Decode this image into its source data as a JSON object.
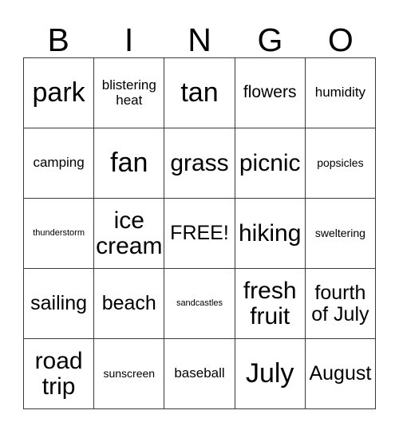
{
  "card": {
    "title_letters": [
      "B",
      "I",
      "N",
      "G",
      "O"
    ],
    "free_space_label": "FREE!",
    "border_color": "#3a3a3a",
    "background_color": "#ffffff",
    "text_color": "#000000",
    "columns": 5,
    "rows": 5,
    "cells": [
      {
        "text": "park",
        "size": "fs-max"
      },
      {
        "text": "blistering heat",
        "size": "fs-md"
      },
      {
        "text": "tan",
        "size": "fs-max"
      },
      {
        "text": "flowers",
        "size": "fs-lg"
      },
      {
        "text": "humidity",
        "size": "fs-md"
      },
      {
        "text": "camping",
        "size": "fs-md"
      },
      {
        "text": "fan",
        "size": "fs-max"
      },
      {
        "text": "grass",
        "size": "fs-xxl"
      },
      {
        "text": "picnic",
        "size": "fs-xxl"
      },
      {
        "text": "popsicles",
        "size": "fs-sm"
      },
      {
        "text": "thunderstorm",
        "size": "fs-xs"
      },
      {
        "text": "ice cream",
        "size": "fs-xxl"
      },
      {
        "text": "FREE!",
        "size": "fs-xl"
      },
      {
        "text": "hiking",
        "size": "fs-xxl"
      },
      {
        "text": "sweltering",
        "size": "fs-sm"
      },
      {
        "text": "sailing",
        "size": "fs-xl"
      },
      {
        "text": "beach",
        "size": "fs-xl"
      },
      {
        "text": "sandcastles",
        "size": "fs-xs"
      },
      {
        "text": "fresh fruit",
        "size": "fs-xxl"
      },
      {
        "text": "fourth of July",
        "size": "fs-xl"
      },
      {
        "text": "road trip",
        "size": "fs-xxl"
      },
      {
        "text": "sunscreen",
        "size": "fs-sm"
      },
      {
        "text": "baseball",
        "size": "fs-md"
      },
      {
        "text": "July",
        "size": "fs-max"
      },
      {
        "text": "August",
        "size": "fs-xl"
      }
    ]
  }
}
